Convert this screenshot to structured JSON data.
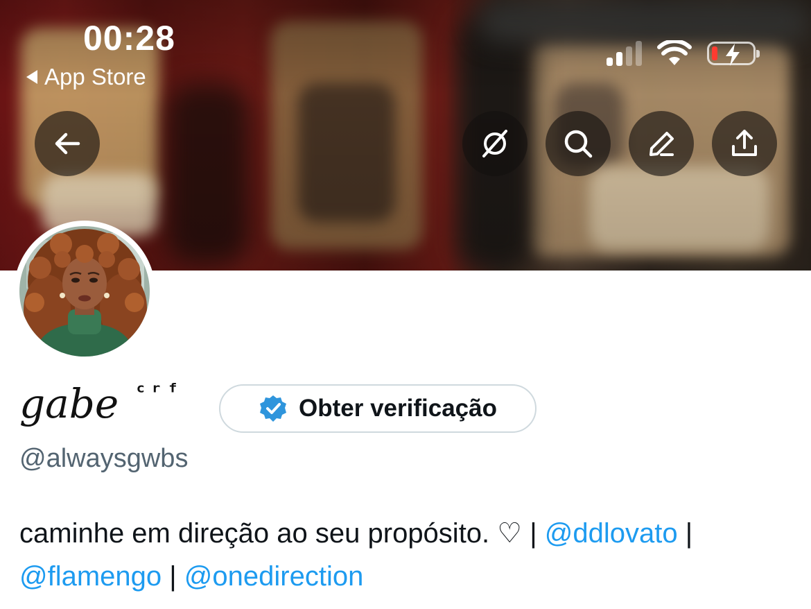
{
  "status_bar": {
    "time": "00:28",
    "back_app": "App Store",
    "signal_icon": "cellular-signal-icon",
    "wifi_icon": "wifi-icon",
    "battery_icon": "battery-charging-icon",
    "battery_level_fraction": 0.1
  },
  "header": {
    "buttons": [
      {
        "name": "back-button",
        "icon": "arrow-left-icon"
      },
      {
        "name": "grok-button",
        "icon": "slashed-circle-icon"
      },
      {
        "name": "search-button",
        "icon": "search-icon"
      },
      {
        "name": "edit-button",
        "icon": "pencil-icon"
      },
      {
        "name": "share-button",
        "icon": "share-upload-icon"
      }
    ]
  },
  "profile": {
    "display_name": "gabe",
    "name_suffix": "ᶜʳᶠ",
    "verify_button_label": "Obter verificação",
    "verify_icon": "verified-badge-icon",
    "handle": "@alwaysgwbs",
    "bio": {
      "text": "caminhe em direção ao seu propósito. ♡",
      "separator": "|",
      "mentions": [
        "@ddlovato",
        "@flamengo",
        "@onedirection"
      ]
    }
  },
  "colors": {
    "link": "#1d9bf0",
    "text_primary": "#0f1419",
    "text_secondary": "#536471",
    "verified_badge": "#2f95dc",
    "banner_red": "#6a1414",
    "battery_low": "#ff3b30"
  }
}
